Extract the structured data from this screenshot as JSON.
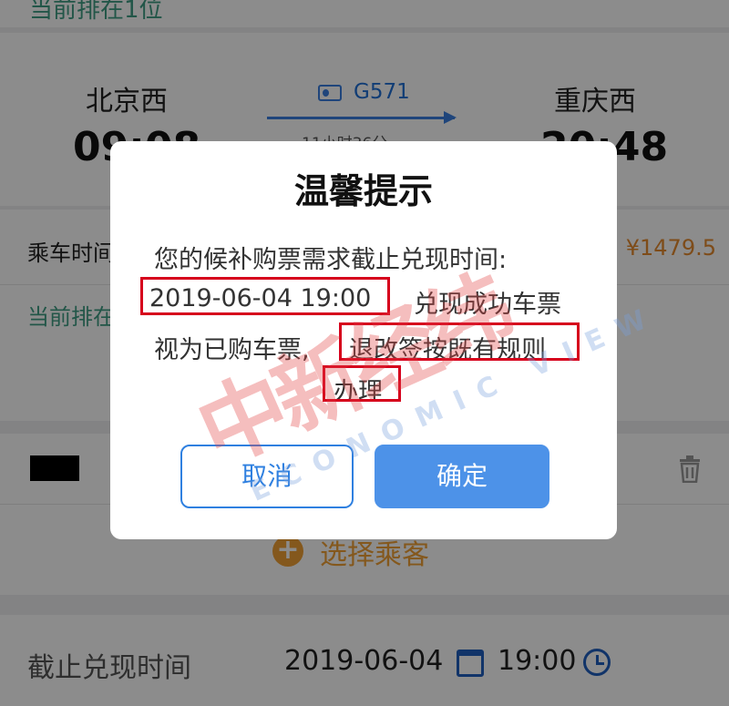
{
  "background": {
    "queue_top": "当前排在1位",
    "from_station": "北京西",
    "to_station": "重庆西",
    "train_number": "G571",
    "depart_time": "09:08",
    "arrive_time": "20:48",
    "duration": "11小时36分",
    "ride_time_label": "乘车时间",
    "price": "¥1479.5",
    "queue_mid": "当前排在",
    "add_passenger_label": "选择乘客",
    "deadline_label": "截止兑现时间",
    "deadline_date": "2019-06-04",
    "deadline_time": "19:00"
  },
  "dialog": {
    "title": "温馨提示",
    "line1": "您的候补购票需求截止兑现时间:",
    "line2_highlight": "2019-06-04 19:00",
    "line2_rest": "兑现成功车票",
    "line3_prefix": "视为已购车票,",
    "line3_highlight": "退改签按既有规则",
    "line4_highlight": "办理",
    "cancel_label": "取消",
    "confirm_label": "确定"
  },
  "watermark": {
    "chinese": "中新经纬",
    "english": "ECONOMIC VIEW"
  },
  "colors": {
    "accent_blue": "#4d92e8",
    "price_orange": "#e68a2e",
    "queue_green": "#3f9d84",
    "highlight_red": "#d6001c"
  }
}
